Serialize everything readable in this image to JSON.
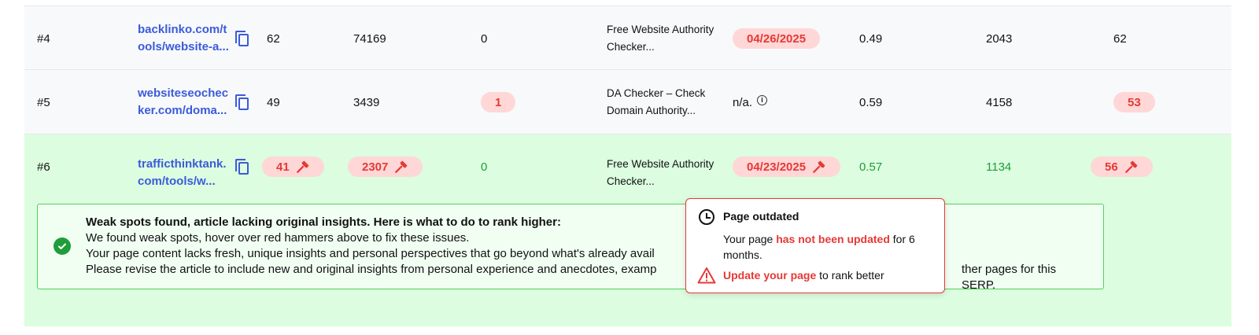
{
  "rows": [
    {
      "rank": "#4",
      "url": "backlinko.com/tools/website-a...",
      "col_a": "62",
      "col_b": "74169",
      "col_c": "0",
      "title": "Free Website Authority Checker...",
      "date": "04/26/2025",
      "col_d": "0.49",
      "col_e": "2043",
      "col_f": "62"
    },
    {
      "rank": "#5",
      "url": "websiteseochecker.com/doma...",
      "col_a": "49",
      "col_b": "3439",
      "col_c": "1",
      "title": "DA Checker – Check Domain Authority...",
      "date": "n/a.",
      "col_d": "0.59",
      "col_e": "4158",
      "col_f": "53"
    },
    {
      "rank": "#6",
      "url": "trafficthinktank.com/tools/w...",
      "col_a": "41",
      "col_b": "2307",
      "col_c": "0",
      "title": "Free Website Authority Checker...",
      "date": "04/23/2025",
      "col_d": "0.57",
      "col_e": "1134",
      "col_f": "56"
    }
  ],
  "insight": {
    "heading": "Weak spots found, article lacking original insights. Here is what to do to rank higher:",
    "line1": "We found weak spots, hover over red hammers above to fix these issues.",
    "line2": "Your page content lacks fresh, unique insights and personal perspectives that go beyond what's already avail",
    "line3": "Please revise the article to include new and original insights from personal experience and anecdotes, examp",
    "line3_tail": "ther pages for this SERP."
  },
  "popup": {
    "title": "Page outdated",
    "body_pre": "Your page ",
    "body_red": "has not been updated",
    "body_post": " for 6 months.",
    "cta_red": "Update your page",
    "cta_post": " to rank better"
  },
  "colors": {
    "link": "#3b5bdb",
    "alert": "#e53935",
    "alert_bg": "#ffd7d7",
    "success": "#1f9d3a",
    "highlight_row": "#dcfddf"
  }
}
